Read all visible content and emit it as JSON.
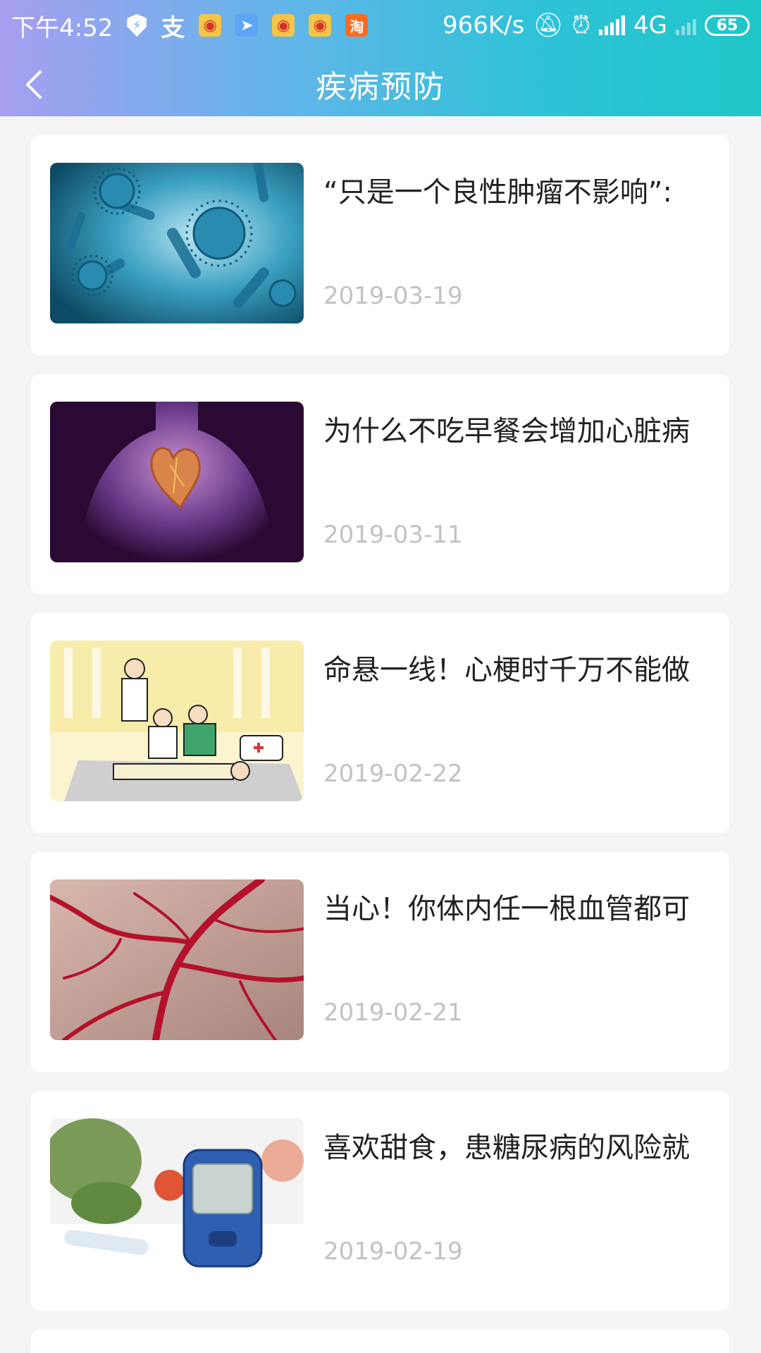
{
  "status_bar": {
    "time": "下午4:52",
    "network_speed": "966K/s",
    "network_type": "4G",
    "battery": "65",
    "app_icons": [
      "shield-icon",
      "alipay-icon",
      "weibo-icon",
      "mail-icon",
      "weibo-icon",
      "weibo-icon",
      "taobao-icon"
    ]
  },
  "header": {
    "title": "疾病预防",
    "gradient_start": "#a79ef0",
    "gradient_end": "#1fc7c9"
  },
  "articles": [
    {
      "title": "“只是一个良性肿瘤不影响”:",
      "date": "2019-03-19",
      "thumbnail": "virus-image"
    },
    {
      "title": "为什么不吃早餐会增加心脏病",
      "date": "2019-03-11",
      "thumbnail": "heart-image"
    },
    {
      "title": "命悬一线！心梗时千万不能做",
      "date": "2019-02-22",
      "thumbnail": "first-aid-image"
    },
    {
      "title": "当心！你体内任一根血管都可",
      "date": "2019-02-21",
      "thumbnail": "blood-vessel-image"
    },
    {
      "title": "喜欢甜食，患糖尿病的风险就",
      "date": "2019-02-19",
      "thumbnail": "glucose-meter-image"
    }
  ],
  "colors": {
    "background": "#f4f4f6",
    "card": "#ffffff",
    "title_text": "#222222",
    "date_text": "#c2c2c2"
  }
}
